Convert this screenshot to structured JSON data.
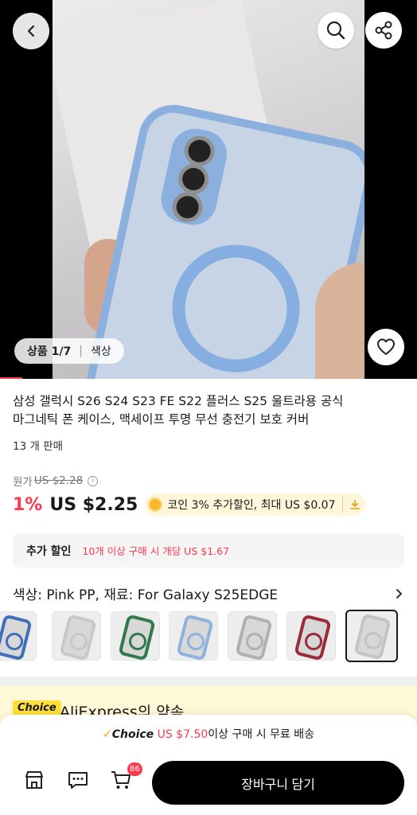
{
  "hero": {
    "image_counter": "상품 1/7",
    "color_tab": "색상"
  },
  "product": {
    "title_line1": "삼성 갤럭시 S26 S24 S23 FE S22 플러스 S25 울트라용 공식",
    "title_line2": "마그네틱 폰 케이스, 맥세이프 투명 무선 충전기 보호 커버",
    "sold": "13 개 판매",
    "original_label": "원가",
    "original_price": "US $2.28",
    "discount": "1%",
    "price": "US $2.25",
    "coin_text": "코인 3% 추가할인, 최대 US $0.07"
  },
  "promo": {
    "label": "추가 할인",
    "text": "10개 이상 구매 시 개당 US $1.67"
  },
  "variant": {
    "text": "색상: Pink PP, 재료: For Galaxy S25EDGE",
    "thumb_colors": [
      "#3e6fb8",
      "#c8c8c8",
      "#2f7a4d",
      "#8fb2dc",
      "#b0b0b0",
      "#9a2c3a",
      "#c4c4c4"
    ],
    "selected_index": 6
  },
  "choice": {
    "badge": "Choice",
    "title": "AliExpress의 약속"
  },
  "shipping": {
    "check": "✓",
    "choice": "Choice",
    "amount": "US $7.50",
    "suffix": "이상 구매 시 무료 배송"
  },
  "bottom_bar": {
    "cart_count": "86",
    "add_to_cart": "장바구니 담기"
  },
  "colors": {
    "accent": "#fd384f",
    "cta": "#000000",
    "choice_yellow": "#ffdf3a"
  }
}
